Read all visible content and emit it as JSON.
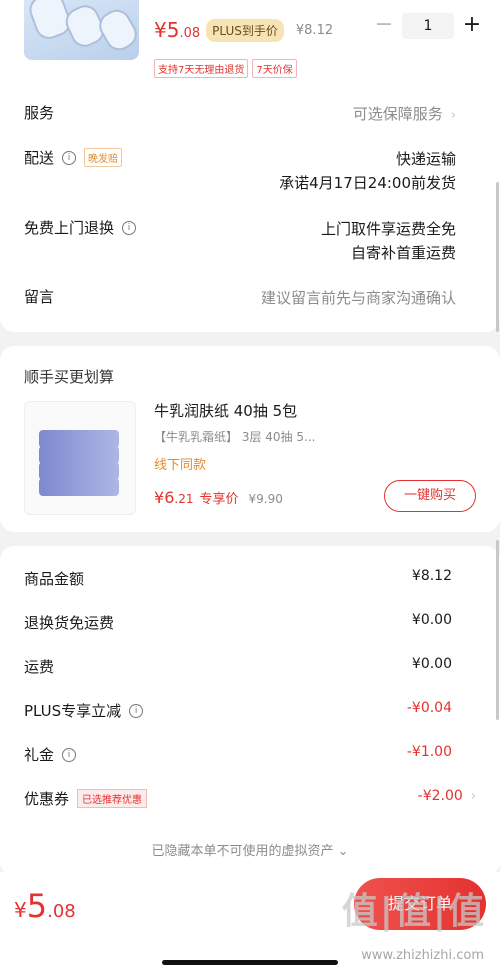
{
  "product": {
    "price_symbol": "¥",
    "price_int": "5",
    "price_dec": ".08",
    "plus_badge": "PLUS到手价",
    "original_price": "¥8.12",
    "quantity": "1",
    "minus": "−",
    "plus": "+",
    "tags": [
      "支持7天无理由退货",
      "7天价保"
    ]
  },
  "service": {
    "label": "服务",
    "value": "可选保障服务",
    "chevron": "›"
  },
  "delivery": {
    "label": "配送",
    "info": "i",
    "late_tag": "晚发赔",
    "method": "快递运输",
    "promise": "承诺4月17日24:00前发货"
  },
  "return": {
    "label": "免费上门退换",
    "info": "i",
    "line1": "上门取件享运费全免",
    "line2": "自寄补首重运费"
  },
  "message": {
    "label": "留言",
    "placeholder": "建议留言前先与商家沟通确认"
  },
  "upsell": {
    "title": "顺手买更划算",
    "name": "牛乳润肤纸 40抽 5包",
    "desc": "【牛乳乳霜纸】 3层 40抽 5...",
    "tag": "线下同款",
    "price_symbol": "¥",
    "price_int": "6",
    "price_dec": ".21",
    "exclusive": "专享价",
    "original": "¥9.90",
    "button": "一键购买"
  },
  "summary": {
    "rows": [
      {
        "label": "商品金额",
        "value": "¥8.12",
        "info": false,
        "red": false,
        "chevron": false
      },
      {
        "label": "退换货免运费",
        "value": "¥0.00",
        "info": false,
        "red": false,
        "chevron": false
      },
      {
        "label": "运费",
        "value": "¥0.00",
        "info": false,
        "red": false,
        "chevron": false
      },
      {
        "label": "PLUS专享立减",
        "value": "-¥0.04",
        "info": true,
        "red": true,
        "chevron": false
      },
      {
        "label": "礼金",
        "value": "-¥1.00",
        "info": true,
        "red": true,
        "chevron": false
      },
      {
        "label": "优惠券",
        "value": "-¥2.00",
        "info": false,
        "red": true,
        "chevron": true,
        "tag": "已选推荐优惠"
      }
    ],
    "hidden_assets": "已隐藏本单不可使用的虚拟资产 ⌄"
  },
  "bottom": {
    "total_symbol": "¥",
    "total_int": "5",
    "total_dec": ".08",
    "submit": "提交订单"
  },
  "watermark": {
    "text": "值|值|值",
    "url": "www.zhizhizhi.com"
  },
  "colors": {
    "accent": "#e3322f",
    "plus_badge_bg": "#f7e4b4",
    "late_tag": "#e28d2e"
  }
}
